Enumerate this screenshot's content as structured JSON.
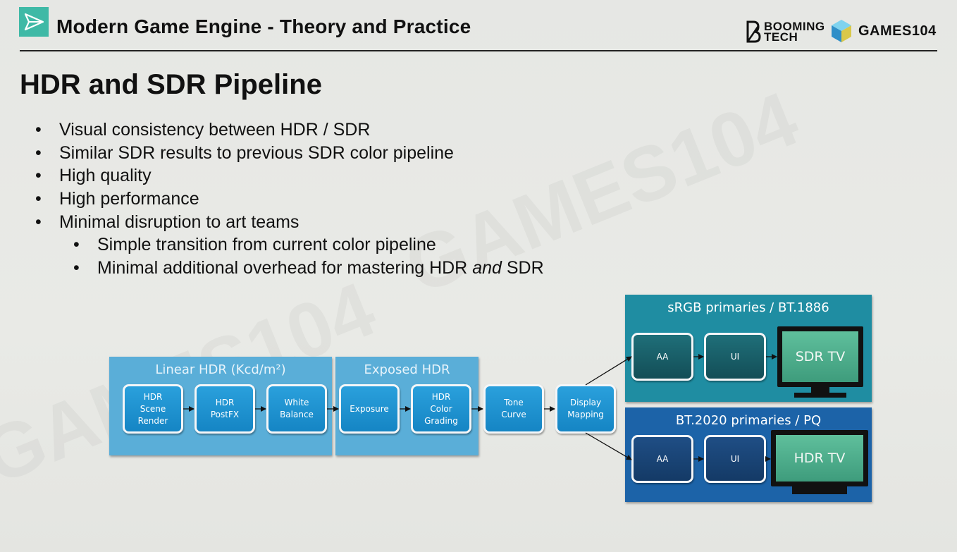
{
  "header": {
    "title": "Modern Game Engine - Theory and Practice",
    "brand_booming_line1": "BOOMING",
    "brand_booming_line2": "TECH",
    "brand_games": "GAMES104"
  },
  "slide": {
    "title": "HDR and SDR Pipeline",
    "bullets": [
      {
        "level": 1,
        "text": "Visual consistency between HDR / SDR"
      },
      {
        "level": 1,
        "text": "Similar SDR results to previous SDR color pipeline"
      },
      {
        "level": 1,
        "text": "High quality"
      },
      {
        "level": 1,
        "text": "High performance"
      },
      {
        "level": 1,
        "text": "Minimal disruption to art teams"
      },
      {
        "level": 2,
        "text": "Simple transition from current color pipeline"
      },
      {
        "level": 2,
        "text_before": "Minimal additional overhead for mastering HDR ",
        "text_em": "and",
        "text_after": " SDR"
      }
    ]
  },
  "diagram": {
    "groups": {
      "linear": "Linear HDR (Kcd/m²)",
      "exposed": "Exposed HDR",
      "srgb": "sRGB primaries / BT.1886",
      "bt2020": "BT.2020 primaries / PQ"
    },
    "nodes": {
      "hdr_scene_render": [
        "HDR",
        "Scene",
        "Render"
      ],
      "hdr_postfx": [
        "HDR",
        "PostFX"
      ],
      "white_balance": [
        "White",
        "Balance"
      ],
      "exposure": [
        "Exposure"
      ],
      "hdr_color_grading": [
        "HDR",
        "Color",
        "Grading"
      ],
      "tone_curve": [
        "Tone",
        "Curve"
      ],
      "display_mapping": [
        "Display",
        "Mapping"
      ],
      "sdr_aa": [
        "AA"
      ],
      "sdr_ui": [
        "UI"
      ],
      "hdr_aa": [
        "AA"
      ],
      "hdr_ui": [
        "UI"
      ]
    },
    "displays": {
      "sdr_tv": "SDR TV",
      "hdr_tv": "HDR TV"
    },
    "colors": {
      "light_group": "#5aaed8",
      "node_blue": "#1a8fd0",
      "srgb_group": "#1f8da2",
      "bt2020_group": "#1c63a8",
      "tv_screen": "#4caa8a"
    }
  }
}
